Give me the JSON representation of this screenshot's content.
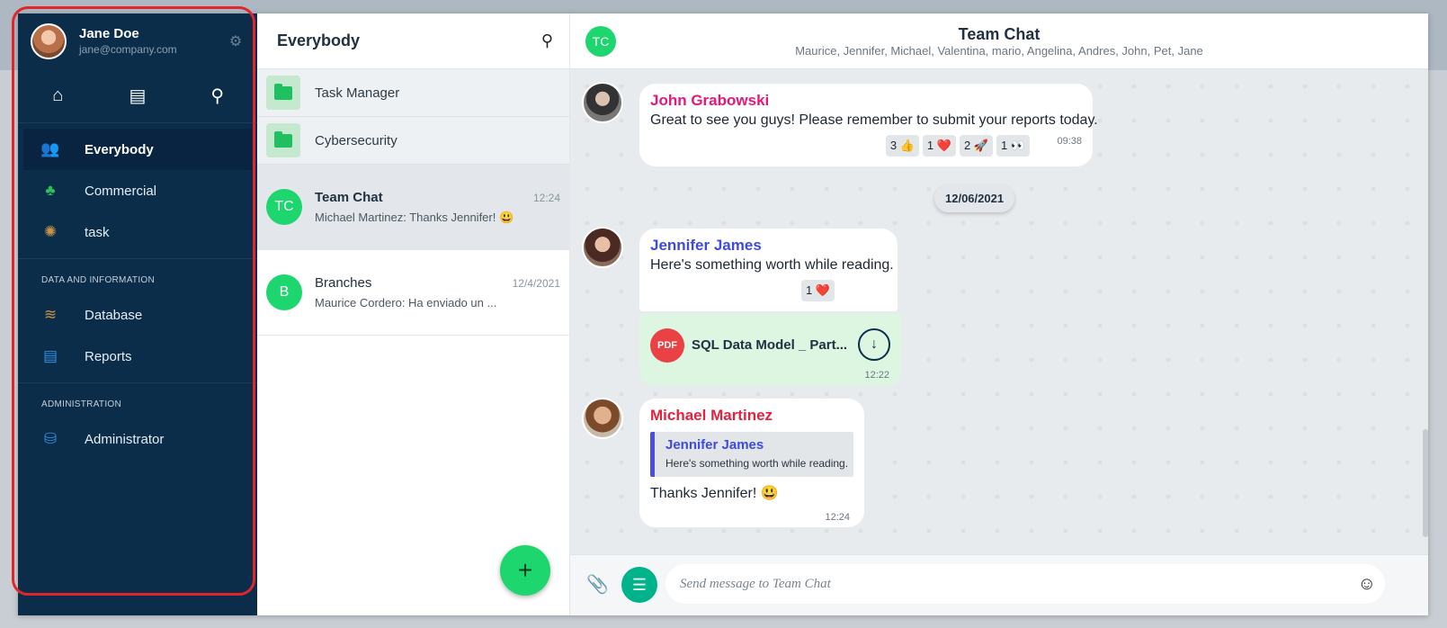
{
  "colors": {
    "sidebar": "#0b2d4a",
    "accent_green": "#1ed66e",
    "highlight": "#e0262b",
    "name_pink": "#e3187a",
    "name_blue": "#3f4ae0",
    "name_red": "#e3223f"
  },
  "profile": {
    "name": "Jane Doe",
    "email": "jane@company.com"
  },
  "sidebar": {
    "icons": [
      "home-icon",
      "contact-card-icon",
      "search-icon"
    ],
    "items": [
      {
        "label": "Everybody",
        "icon": "group-icon"
      },
      {
        "label": "Commercial",
        "icon": "club-icon"
      },
      {
        "label": "task",
        "icon": "gear-icon"
      },
      {
        "label": "Database",
        "icon": "database-icon"
      },
      {
        "label": "Reports",
        "icon": "document-icon"
      },
      {
        "label": "Administrator",
        "icon": "admin-icon"
      }
    ],
    "sections": [
      "DATA AND INFORMATION",
      "ADMINISTRATION"
    ]
  },
  "chatlist": {
    "title": "Everybody",
    "folders": [
      "Task Manager",
      "Cybersecurity"
    ],
    "chats": [
      {
        "initials": "TC",
        "name": "Team Chat",
        "time": "12:24",
        "preview": "Michael Martinez: Thanks Jennifer! 😃"
      },
      {
        "initials": "B",
        "name": "Branches",
        "time": "12/4/2021",
        "preview": "Maurice Cordero: Ha enviado un ..."
      }
    ],
    "fab": "+"
  },
  "conversation": {
    "initials": "TC",
    "title": "Team Chat",
    "members": "Maurice, Jennifer, Michael, Valentina, mario, Angelina, Andres, John, Pet, Jane",
    "date_separator": "12/06/2021",
    "messages": [
      {
        "author": "John Grabowski",
        "text": "Great to see you guys! Please remember to submit your reports today.",
        "time": "09:38",
        "reactions": [
          "3 👍",
          "1 ❤️",
          "2 🚀",
          "1 👀"
        ]
      },
      {
        "author": "Jennifer James",
        "text": "Here's something worth while reading.",
        "reactions": [
          "1 ❤️"
        ]
      },
      {
        "file": "SQL Data Model _ Part...",
        "time": "12:22"
      },
      {
        "author": "Michael Martinez",
        "quote_author": "Jennifer James",
        "quote_text": "Here's something worth while reading.",
        "text": "Thanks Jennifer! 😃",
        "time": "12:24"
      }
    ],
    "composer_placeholder": "Send message to Team Chat"
  }
}
